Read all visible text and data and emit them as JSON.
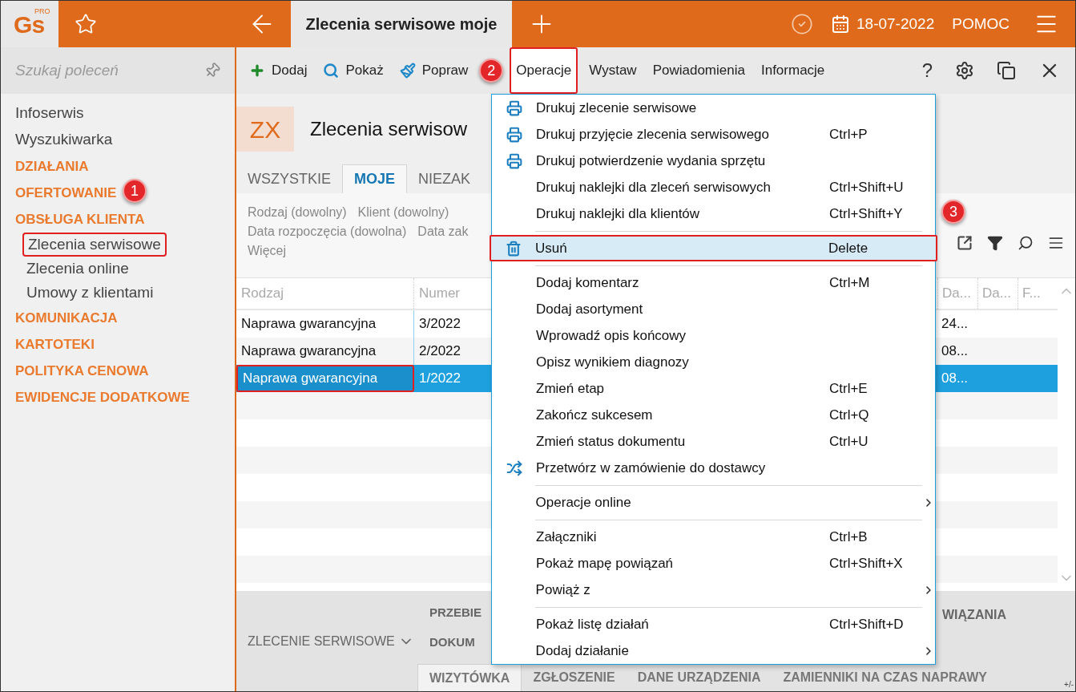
{
  "app": {
    "logo": "Gs",
    "logo_badge": "PRO"
  },
  "top_bar": {
    "tab": "Zlecenia serwisowe moje",
    "date": "18-07-2022",
    "help": "POMOC"
  },
  "sidebar": {
    "search": {
      "placeholder": "Szukaj poleceń"
    },
    "items": [
      {
        "label": "Infoserwis",
        "kind": "link"
      },
      {
        "label": "Wyszukiwarka",
        "kind": "link"
      },
      {
        "label": "DZIAŁANIA",
        "kind": "section"
      },
      {
        "label": "OFERTOWANIE",
        "kind": "section"
      },
      {
        "label": "OBSŁUGA KLIENTA",
        "kind": "section",
        "children": [
          {
            "label": "Zlecenia serwisowe",
            "highlighted": true
          },
          {
            "label": "Zlecenia online",
            "highlighted": false
          },
          {
            "label": "Umowy z klientami",
            "highlighted": false
          }
        ]
      },
      {
        "label": "KOMUNIKACJA",
        "kind": "section"
      },
      {
        "label": "KARTOTEKI",
        "kind": "section"
      },
      {
        "label": "POLITYKA CENOWA",
        "kind": "section"
      },
      {
        "label": "EWIDENCJE DODATKOWE",
        "kind": "section"
      }
    ]
  },
  "toolbar": {
    "items": [
      {
        "label": "Dodaj",
        "open": false,
        "highlighted": false
      },
      {
        "label": "Pokaż",
        "open": false,
        "highlighted": false
      },
      {
        "label": "Popraw",
        "open": false,
        "highlighted": false
      },
      {
        "label": "Operacje",
        "open": true,
        "highlighted": true
      },
      {
        "label": "Wystaw",
        "open": false,
        "highlighted": false
      },
      {
        "label": "Powiadomienia",
        "open": false,
        "highlighted": false
      },
      {
        "label": "Informacje",
        "open": false,
        "highlighted": false
      }
    ],
    "help_glyph": "?"
  },
  "document": {
    "badge": "ZX",
    "title": "Zlecenia serwisow",
    "tabs": [
      {
        "label": "WSZYSTKIE",
        "selected": false
      },
      {
        "label": "MOJE",
        "selected": true
      },
      {
        "label": "NIEZAK",
        "selected": false
      }
    ],
    "filters": [
      [
        "Rodzaj (dowolny)",
        "Klient (dowolny)"
      ],
      [
        "Data rozpoczęcia (dowolna)",
        "Data zak"
      ],
      [
        "Więcej"
      ]
    ]
  },
  "table": {
    "columns": [
      "Rodzaj",
      "Numer"
    ],
    "right_columns": [
      "Da...",
      "Da...",
      "F..."
    ],
    "rows": [
      {
        "cells": [
          "Naprawa gwarancyjna",
          "3/2022"
        ],
        "right_cells": [
          "24..."
        ],
        "selected": false,
        "highlighted": false
      },
      {
        "cells": [
          "Naprawa gwarancyjna",
          "2/2022"
        ],
        "right_cells": [
          "08..."
        ],
        "selected": false,
        "highlighted": false
      },
      {
        "cells": [
          "Naprawa gwarancyjna",
          "1/2022"
        ],
        "right_cells": [
          "08..."
        ],
        "selected": true,
        "highlighted": true
      }
    ]
  },
  "bottom": {
    "section": "ZLECENIE SERWISOWE",
    "links": [
      "PRZEBIE",
      "DOKUM"
    ],
    "right_link": "WIĄZANIA",
    "tabs": [
      {
        "label": "WIZYTÓWKA",
        "selected": true
      },
      {
        "label": "ZGŁOSZENIE",
        "selected": false
      },
      {
        "label": "DANE URZĄDZENIA",
        "selected": false
      },
      {
        "label": "ZAMIENNIKI NA CZAS NAPRAWY",
        "selected": false
      }
    ],
    "corner": "+/-"
  },
  "menu": {
    "items": [
      {
        "kind": "print",
        "label": "Drukuj zlecenie serwisowe",
        "selected": false,
        "highlighted": false
      },
      {
        "kind": "print",
        "label": "Drukuj przyjęcie zlecenia serwisowego",
        "shortcut": "Ctrl+P",
        "selected": false,
        "highlighted": false
      },
      {
        "kind": "print",
        "label": "Drukuj potwierdzenie wydania sprzętu",
        "selected": false,
        "highlighted": false
      },
      {
        "kind": "item",
        "label": "Drukuj naklejki dla zleceń serwisowych",
        "shortcut": "Ctrl+Shift+U",
        "selected": false,
        "highlighted": false
      },
      {
        "kind": "item",
        "label": "Drukuj naklejki dla klientów",
        "shortcut": "Ctrl+Shift+Y",
        "selected": false,
        "highlighted": false
      },
      {
        "kind": "separator"
      },
      {
        "kind": "delete",
        "label": "Usuń",
        "shortcut": "Delete",
        "selected": true,
        "highlighted": true
      },
      {
        "kind": "separator"
      },
      {
        "kind": "item",
        "label": "Dodaj komentarz",
        "shortcut": "Ctrl+M",
        "selected": false,
        "highlighted": false
      },
      {
        "kind": "item",
        "label": "Dodaj asortyment",
        "selected": false,
        "highlighted": false
      },
      {
        "kind": "item",
        "label": "Wprowadź opis końcowy",
        "selected": false,
        "highlighted": false
      },
      {
        "kind": "item",
        "label": "Opisz wynikiem diagnozy",
        "selected": false,
        "highlighted": false
      },
      {
        "kind": "item",
        "label": "Zmień etap",
        "shortcut": "Ctrl+E",
        "selected": false,
        "highlighted": false
      },
      {
        "kind": "item",
        "label": "Zakończ sukcesem",
        "shortcut": "Ctrl+Q",
        "selected": false,
        "highlighted": false
      },
      {
        "kind": "item",
        "label": "Zmień status dokumentu",
        "shortcut": "Ctrl+U",
        "selected": false,
        "highlighted": false
      },
      {
        "kind": "convert",
        "label": "Przetwórz w zamówienie do dostawcy",
        "selected": false,
        "highlighted": false
      },
      {
        "kind": "separator"
      },
      {
        "kind": "submenu",
        "label": "Operacje online",
        "selected": false,
        "highlighted": false
      },
      {
        "kind": "separator"
      },
      {
        "kind": "item",
        "label": "Załączniki",
        "shortcut": "Ctrl+B",
        "selected": false,
        "highlighted": false
      },
      {
        "kind": "item",
        "label": "Pokaż mapę powiązań",
        "shortcut": "Ctrl+Shift+X",
        "selected": false,
        "highlighted": false
      },
      {
        "kind": "submenu",
        "label": "Powiąż z",
        "selected": false,
        "highlighted": false
      },
      {
        "kind": "separator"
      },
      {
        "kind": "item",
        "label": "Pokaż listę działań",
        "shortcut": "Ctrl+Shift+D",
        "selected": false,
        "highlighted": false
      },
      {
        "kind": "submenu",
        "label": "Dodaj działanie",
        "selected": false,
        "highlighted": false
      }
    ]
  },
  "step_markers": [
    "1",
    "2",
    "3"
  ]
}
